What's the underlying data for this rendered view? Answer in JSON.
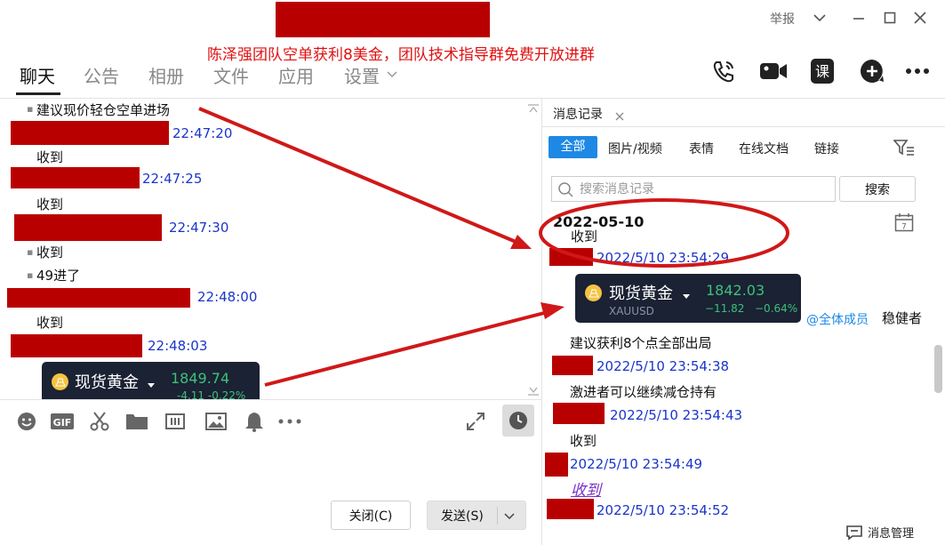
{
  "window": {
    "banner": "陈泽强团队空单获利8美金，团队技术指导群免费开放进群",
    "report_label": "举报"
  },
  "tabs": [
    {
      "label": "聊天",
      "active": true
    },
    {
      "label": "公告"
    },
    {
      "label": "相册"
    },
    {
      "label": "文件"
    },
    {
      "label": "应用"
    },
    {
      "label": "设置"
    }
  ],
  "chat": {
    "messages": [
      {
        "text": "建议现价轻仓空单进场",
        "bullet": true
      },
      {
        "time": "22:47:20"
      },
      {
        "text": "收到"
      },
      {
        "time": "22:47:25"
      },
      {
        "text": "收到"
      },
      {
        "time": "22:47:30"
      },
      {
        "text": "收到",
        "bullet": true
      },
      {
        "text": "49进了",
        "bullet": true
      },
      {
        "time": "22:48:00"
      },
      {
        "text": "收到"
      },
      {
        "time": "22:48:03"
      }
    ],
    "gold_card": {
      "name": "现货黄金",
      "price": "1849.74",
      "sub": "-4.11   -0.22%"
    }
  },
  "toolbar": {
    "gif_label": "GIF",
    "close_label": "关闭(C)",
    "send_label": "发送(S)"
  },
  "history": {
    "tab_label": "消息记录",
    "filters": [
      "全部",
      "图片/视频",
      "表情",
      "在线文档",
      "链接"
    ],
    "search_placeholder": "搜索消息记录",
    "search_button": "搜索",
    "date": "2022-05-10",
    "calendar_day": "7",
    "items": {
      "clipped_text": "收到",
      "t1": "2022/5/10 23:54:29",
      "mention": "@全体成员",
      "mention_text": "稳健者",
      "text2": "建议获利8个点全部出局",
      "t2": "2022/5/10 23:54:38",
      "text3": "激进者可以继续减仓持有",
      "t3": "2022/5/10 23:54:43",
      "text4": "收到",
      "t4": "2022/5/10 23:54:49",
      "text5": "收到",
      "t5": "2022/5/10 23:54:52"
    },
    "gold_card": {
      "name": "现货黄金",
      "price": "1842.03",
      "symbol": "XAUUSD",
      "change": "−11.82",
      "change_pct": "−0.64%"
    },
    "manage_label": "消息管理"
  },
  "colors": {
    "redaction": "#b90000",
    "time_blue": "#1a35c9",
    "accent_blue": "#1e88e5",
    "banner_red": "#e01010",
    "annotation_red": "#d01818"
  }
}
